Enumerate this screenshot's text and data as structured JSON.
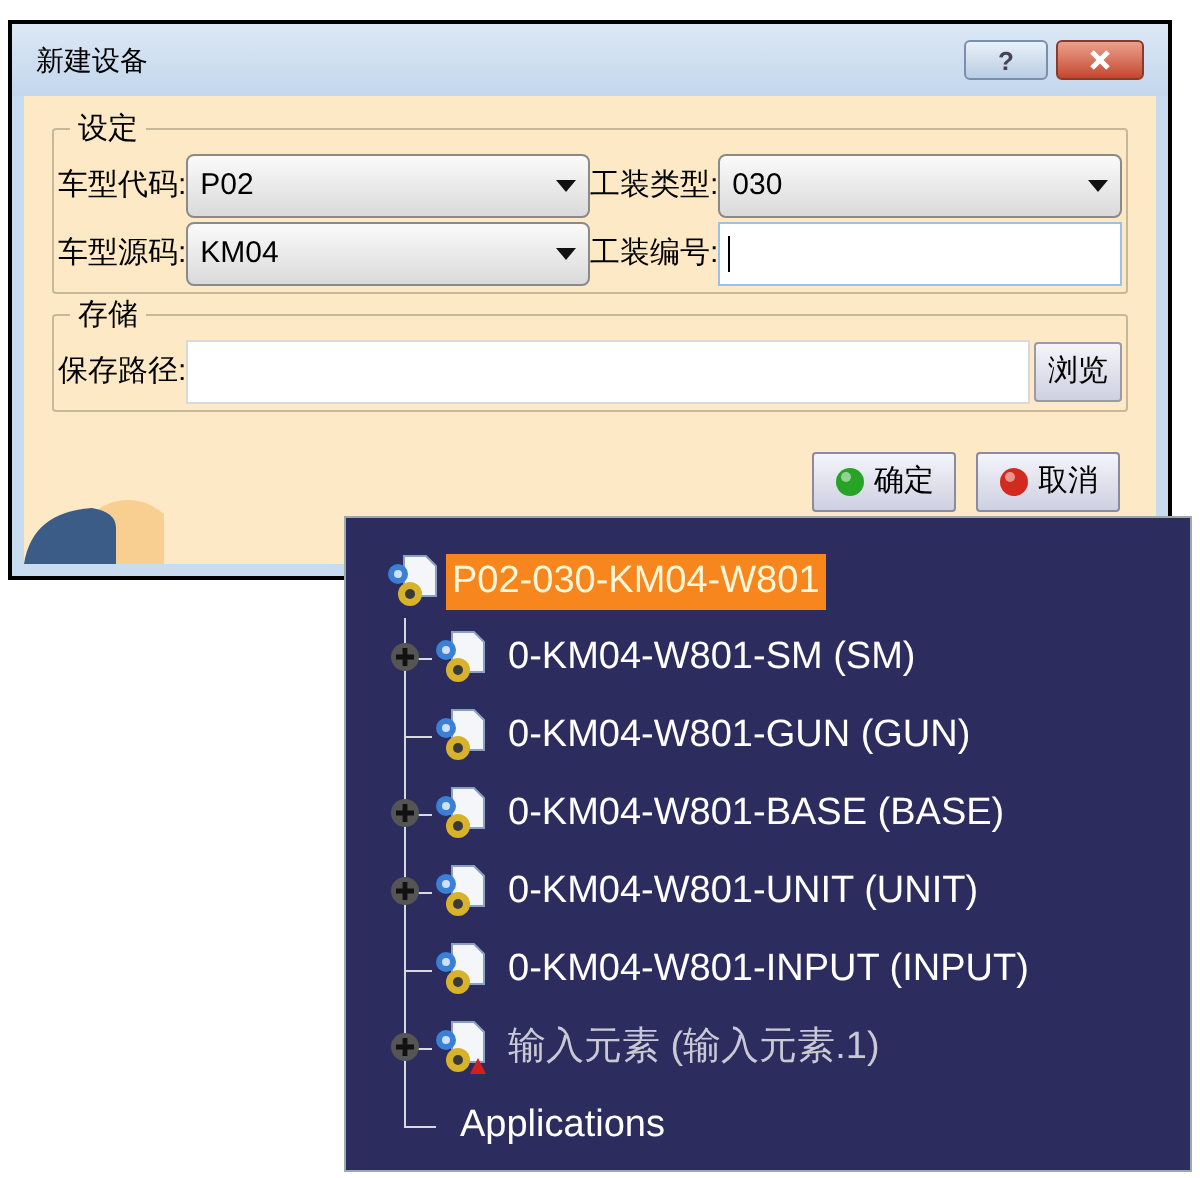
{
  "dialog": {
    "title": "新建设备",
    "help_button": "?",
    "groups": [
      {
        "title": "设定",
        "fields": [
          {
            "label": "车型代码:",
            "kind": "combo",
            "value": "P02",
            "focused": false
          },
          {
            "label": "工装类型:",
            "kind": "combo",
            "value": "030",
            "focused": false
          },
          {
            "label": "车型源码:",
            "kind": "combo",
            "value": "KM04",
            "focused": false
          },
          {
            "label": "工装编号:",
            "kind": "text",
            "focused": true
          }
        ]
      },
      {
        "title": "存储",
        "fields": [
          {
            "label": "保存路径:",
            "kind": "path",
            "focused": false,
            "button": "浏览"
          }
        ]
      }
    ],
    "buttons": [
      {
        "label": "确定",
        "kind": "ok"
      },
      {
        "label": "取消",
        "kind": "cancel"
      }
    ]
  },
  "tree": {
    "label": "P02-030-KM04-W801",
    "kind": "product",
    "selected": true,
    "children": [
      {
        "label": "0-KM04-W801-SM (SM)",
        "kind": "product",
        "selected": false,
        "dimmed": false,
        "expandable": true
      },
      {
        "label": "0-KM04-W801-GUN (GUN)",
        "kind": "product",
        "selected": false,
        "dimmed": false,
        "expandable": false
      },
      {
        "label": "0-KM04-W801-BASE (BASE)",
        "kind": "product",
        "selected": false,
        "dimmed": false,
        "expandable": true
      },
      {
        "label": "0-KM04-W801-UNIT (UNIT)",
        "kind": "product",
        "selected": false,
        "dimmed": false,
        "expandable": true
      },
      {
        "label": "0-KM04-W801-INPUT (INPUT)",
        "kind": "product",
        "selected": false,
        "dimmed": false,
        "expandable": false
      },
      {
        "label": "输入元素 (输入元素.1)",
        "kind": "input",
        "selected": false,
        "dimmed": true,
        "expandable": true
      },
      {
        "label": "Applications",
        "kind": "plain",
        "selected": false,
        "dimmed": false,
        "expandable": false
      }
    ]
  }
}
